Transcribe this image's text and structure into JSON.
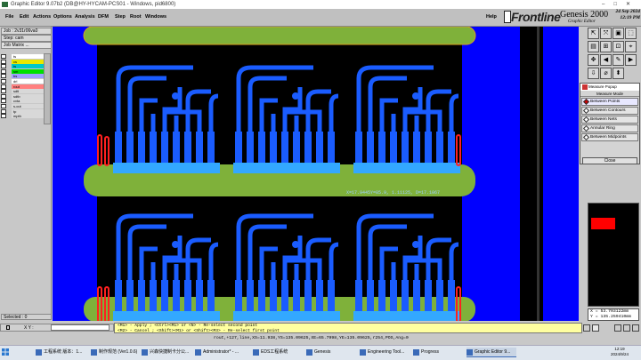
{
  "window": {
    "title": "Graphic Editor 9.07b2 (DB@HY-HYCAM-PCS01 - Windows, pid6800)"
  },
  "menu": {
    "items": [
      {
        "label": "File"
      },
      {
        "label": "Edit"
      },
      {
        "label": "Actions"
      },
      {
        "label": "Options"
      },
      {
        "label": "Analysis"
      },
      {
        "label": "DFM"
      },
      {
        "label": "Step"
      },
      {
        "label": "Root"
      },
      {
        "label": "Windows"
      }
    ],
    "help": "Help"
  },
  "brand": {
    "logo": "Frontline",
    "product": "Genesis 2000",
    "subtitle": "Graphic Editor",
    "date": "24 Sep 2024",
    "time": "12:19 PM"
  },
  "left": {
    "job": "Job : 2v31r06va0",
    "step": "Step: cam",
    "job_matrix": "Job Matrix ...",
    "layers": [
      {
        "name": "ts",
        "color": "#ffffff"
      },
      {
        "name": "cs",
        "color": "#e8e800"
      },
      {
        "name": "ts",
        "color": "#00c8c8"
      },
      {
        "name": "sm",
        "color": "#00e000"
      },
      {
        "name": "bs",
        "color": "#a0a0ff"
      },
      {
        "name": "drl",
        "color": "#ffffff"
      },
      {
        "name": "rout",
        "color": "#ff8080"
      },
      {
        "name": "sdtl",
        "color": "#d8d8d8"
      },
      {
        "name": "sdtb",
        "color": "#d8d8d8"
      },
      {
        "name": "cvta",
        "color": "#d8d8d8"
      },
      {
        "name": "s-cut",
        "color": "#d8d8d8"
      },
      {
        "name": "tp",
        "color": "#d8d8d8"
      },
      {
        "name": "mpth",
        "color": "#d8d8d8"
      }
    ],
    "selected": "Selected : 0"
  },
  "canvas": {
    "measure_text": "X=17.9445Y=85.9,  1.11125,  D=17.1067"
  },
  "popup": {
    "title": "Measure Popup",
    "mode_label": "Measure Mode",
    "options": [
      {
        "label": "Between Points",
        "selected": true
      },
      {
        "label": "Between Contours",
        "selected": false
      },
      {
        "label": "Between Nets",
        "selected": false
      },
      {
        "label": "Annular Ring",
        "selected": false
      },
      {
        "label": "Between Midpoints",
        "selected": false
      }
    ],
    "close": "Close"
  },
  "coords": {
    "x": "X = 53.703122mm",
    "y": "Y = 135.259410mm"
  },
  "status": {
    "xy_label": "X Y :",
    "line1": "<M1> - Apply ; <Ctrl><M1> or <N> - Re-select second point",
    "line2": "<M2> - Cancel ; <Shift><M1> or <Shift><M3> - Re-select first point",
    "command": "rout,+127,line,XS=11.938,YS=135.09625,XE=65.7998,YE=135.09625,r254,POS,Ang=0"
  },
  "taskbar": {
    "items": [
      {
        "label": "工程系统   版本：1..."
      },
      {
        "label": "制作规范 (Ver1.0.6)"
      },
      {
        "label": "兴森快捷制卡分公..."
      },
      {
        "label": "Administrator* - ..."
      },
      {
        "label": "EDS工程系统"
      },
      {
        "label": "Genesis"
      },
      {
        "label": "Engineering Tool..."
      },
      {
        "label": "Progress"
      },
      {
        "label": "Graphic Editor 9..."
      }
    ],
    "time": "12:19",
    "date": "2024/9/24"
  },
  "colors": {
    "canvas_bg": "#0000ff",
    "board": "#000000",
    "trace": "#1a5cff",
    "panel": "#7fb13a",
    "cyan": "#33a8ff",
    "red": "#ff0000"
  }
}
